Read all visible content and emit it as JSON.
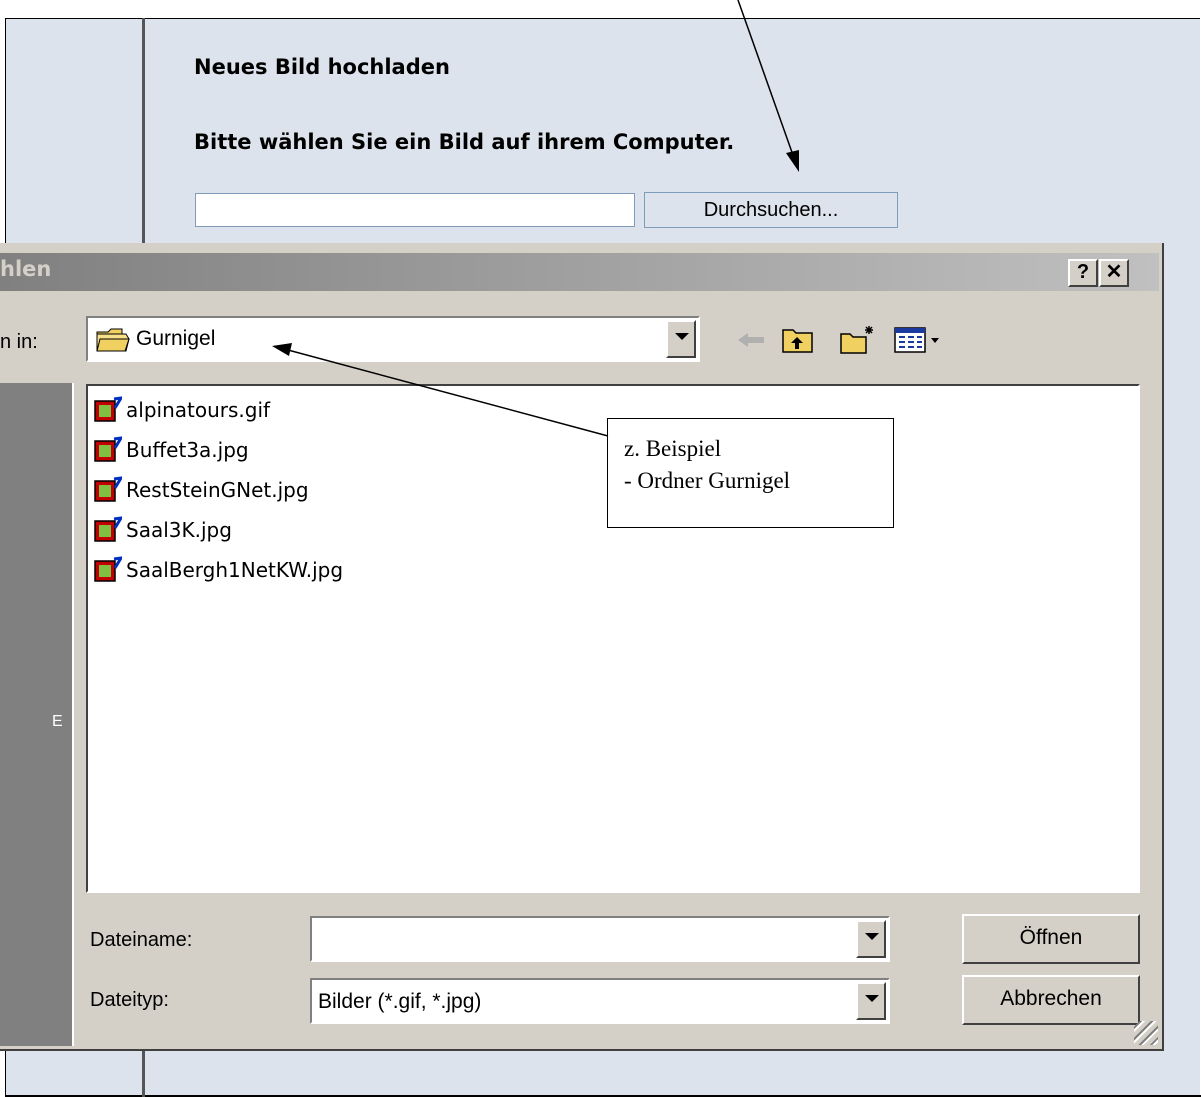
{
  "web_page": {
    "title": "Neues Bild hochladen",
    "subtitle": "Bitte wählen Sie ein Bild auf ihrem Computer.",
    "file_input_value": "",
    "browse_button": "Durchsuchen..."
  },
  "dialog": {
    "title_partial": "hlen",
    "help_button": "?",
    "close_button": "✕",
    "look_in_label_partial": "n in:",
    "look_in_value": "Gurnigel",
    "files": [
      "alpinatours.gif",
      "Buffet3a.jpg",
      "RestSteinGNet.jpg",
      "Saal3K.jpg",
      "SaalBergh1NetKW.jpg"
    ],
    "places_label_partial": "E",
    "filename_label": "Dateiname:",
    "filename_value": "",
    "filetype_label": "Dateityp:",
    "filetype_value": "Bilder (*.gif, *.jpg)",
    "open_button": "Öffnen",
    "cancel_button": "Abbrechen"
  },
  "annotation": {
    "line1": "z. Beispiel",
    "line2": "- Ordner Gurnigel"
  },
  "colors": {
    "page_background": "#dde3ec",
    "dialog_background": "#d4d0c8",
    "titlebar_inactive": "#808080",
    "folder_yellow": "#f0d060",
    "file_icon_red": "#c00000"
  },
  "icons": [
    "folder-icon",
    "back-icon",
    "up-folder-icon",
    "new-folder-icon",
    "view-menu-icon",
    "image-file-icon"
  ]
}
